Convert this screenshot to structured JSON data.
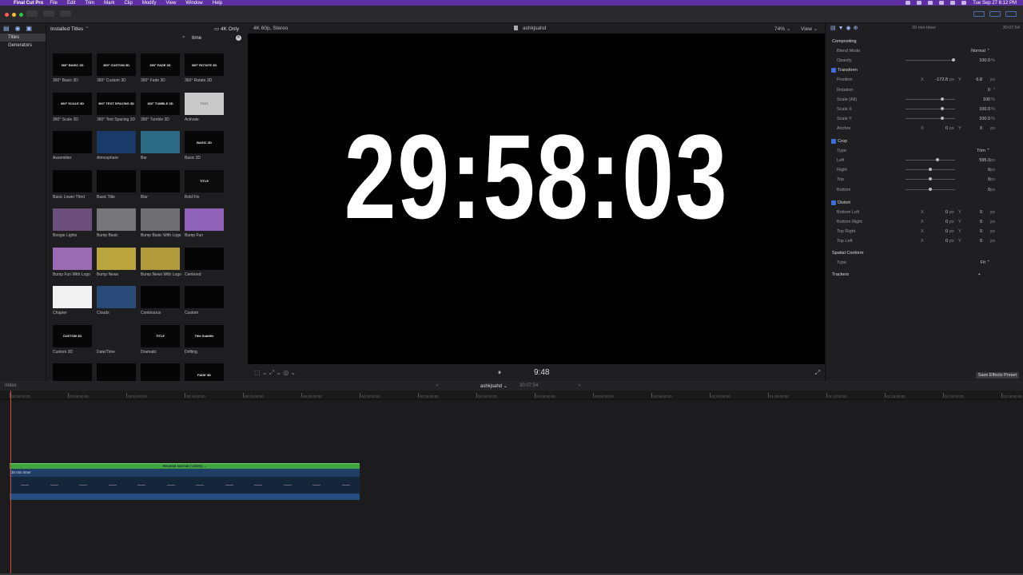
{
  "menubar": {
    "app": "Final Cut Pro",
    "items": [
      "File",
      "Edit",
      "Trim",
      "Mark",
      "Clip",
      "Modify",
      "View",
      "Window",
      "Help"
    ],
    "clock": "Tue Sep 27  6:12 PM"
  },
  "sidebar": {
    "items": [
      {
        "label": "Titles",
        "selected": true
      },
      {
        "label": "Generators",
        "selected": false
      }
    ]
  },
  "browser": {
    "title": "Installed Titles",
    "filter": "4K Only",
    "search_value": "time",
    "tiles": [
      {
        "name": "360° Basic 3D",
        "thumb": "360° BASIC 3D",
        "bg": "#070707"
      },
      {
        "name": "360° Custom 3D",
        "thumb": "360° CUSTOM 3D",
        "bg": "#070707"
      },
      {
        "name": "360° Fade 3D",
        "thumb": "360° FADE 3D",
        "bg": "#070707"
      },
      {
        "name": "360° Rotate 3D",
        "thumb": "360° ROTATE 3D",
        "bg": "#070707"
      },
      {
        "name": "360° Scale 3D",
        "thumb": "360° SCALE 3D",
        "bg": "#070707"
      },
      {
        "name": "360° Text Spacing 3D",
        "thumb": "360° TEXT SPACING 3D",
        "bg": "#070707"
      },
      {
        "name": "360° Tumble 3D",
        "thumb": "360° TUMBLE 3D",
        "bg": "#070707"
      },
      {
        "name": "Activate",
        "thumb": "TEXT",
        "bg": "#c9c9c9"
      },
      {
        "name": "Assembler",
        "thumb": "",
        "bg": "#050505"
      },
      {
        "name": "Atmosphere",
        "thumb": "",
        "bg": "#1b3a6a"
      },
      {
        "name": "Bar",
        "thumb": "",
        "bg": "#2a6a84"
      },
      {
        "name": "Basic 3D",
        "thumb": "BASIC 3D",
        "bg": "#070707"
      },
      {
        "name": "Basic Lower Third",
        "thumb": "",
        "bg": "#050505"
      },
      {
        "name": "Basic Title",
        "thumb": "",
        "bg": "#050505"
      },
      {
        "name": "Blur",
        "thumb": "",
        "bg": "#050505"
      },
      {
        "name": "Bold Fin",
        "thumb": "TITLE",
        "bg": "#0b0b0b"
      },
      {
        "name": "Boogie Lights",
        "thumb": "",
        "bg": "#6b4f7a"
      },
      {
        "name": "Bump Basic",
        "thumb": "",
        "bg": "#77777a"
      },
      {
        "name": "Bump Basic With Logo",
        "thumb": "",
        "bg": "#6f6f72"
      },
      {
        "name": "Bump Fun",
        "thumb": "",
        "bg": "#8e63b8"
      },
      {
        "name": "Bump Fun With Logo",
        "thumb": "",
        "bg": "#9a6bb3"
      },
      {
        "name": "Bump News",
        "thumb": "",
        "bg": "#b9a43e"
      },
      {
        "name": "Bump News With Logo",
        "thumb": "",
        "bg": "#b09a3a"
      },
      {
        "name": "Centered",
        "thumb": "",
        "bg": "#050505"
      },
      {
        "name": "Chapter",
        "thumb": "",
        "bg": "#f2f2f2"
      },
      {
        "name": "Clouds",
        "thumb": "",
        "bg": "#2a4a7a"
      },
      {
        "name": "Continuous",
        "thumb": "",
        "bg": "#050505"
      },
      {
        "name": "Custom",
        "thumb": "",
        "bg": "#050505"
      },
      {
        "name": "Custom 3D",
        "thumb": "CUSTOM 3D",
        "bg": "#070707"
      },
      {
        "name": "Date/Time",
        "thumb": "",
        "bg": "#1e1e20"
      },
      {
        "name": "Dramatic",
        "thumb": "TITLE",
        "bg": "#070707"
      },
      {
        "name": "Drifting",
        "thumb": "Title Subtitle",
        "bg": "#070707"
      },
      {
        "name": "",
        "thumb": "",
        "bg": "#050505"
      },
      {
        "name": "",
        "thumb": "",
        "bg": "#050505"
      },
      {
        "name": "",
        "thumb": "",
        "bg": "#050505"
      },
      {
        "name": "",
        "thumb": "FADE 3D",
        "bg": "#070707"
      }
    ]
  },
  "viewer": {
    "format": "4K 60p, Stereo",
    "project": "ashkjsahd",
    "zoom": "74%",
    "view_menu": "View",
    "frame_text": "29:58:03",
    "timecode": "9:48"
  },
  "inspector": {
    "clip_name": "30 min timer",
    "duration": "30:07:54",
    "rows": [
      {
        "type": "section",
        "label": "Compositing"
      },
      {
        "type": "field",
        "label": "Blend Mode",
        "value": "Normal ⌃"
      },
      {
        "type": "slider",
        "label": "Opacity",
        "value": "100.0",
        "unit": "%",
        "level": 1.0
      },
      {
        "type": "section-check",
        "label": "Transform"
      },
      {
        "type": "xy",
        "label": "Position",
        "x": "-172.8",
        "x_unit": "px",
        "y": "6.8",
        "y_unit": "px"
      },
      {
        "type": "field",
        "label": "Rotation",
        "value": "0",
        "unit": "°"
      },
      {
        "type": "slider",
        "label": "Scale (All)",
        "value": "100",
        "unit": "%",
        "level": 0.75
      },
      {
        "type": "slider",
        "label": "Scale X",
        "value": "100.0",
        "unit": "%",
        "level": 0.75
      },
      {
        "type": "slider",
        "label": "Scale Y",
        "value": "100.0",
        "unit": "%",
        "level": 0.75
      },
      {
        "type": "xy",
        "label": "Anchor",
        "x": "0",
        "x_unit": "px",
        "y": "0",
        "y_unit": "px"
      },
      {
        "type": "section-check",
        "label": "Crop"
      },
      {
        "type": "field",
        "label": "Type",
        "value": "Trim ⌃"
      },
      {
        "type": "slider",
        "label": "Left",
        "value": "595.0",
        "unit": "px",
        "level": 0.65
      },
      {
        "type": "slider",
        "label": "Right",
        "value": "0",
        "unit": "px",
        "level": 0.5
      },
      {
        "type": "slider",
        "label": "Top",
        "value": "0",
        "unit": "px",
        "level": 0.5
      },
      {
        "type": "slider",
        "label": "Bottom",
        "value": "0",
        "unit": "px",
        "level": 0.5
      },
      {
        "type": "section-check",
        "label": "Distort"
      },
      {
        "type": "xy",
        "label": "Bottom Left",
        "x": "0",
        "x_unit": "px",
        "y": "0",
        "y_unit": "px"
      },
      {
        "type": "xy",
        "label": "Bottom Right",
        "x": "0",
        "x_unit": "px",
        "y": "0",
        "y_unit": "px"
      },
      {
        "type": "xy",
        "label": "Top Right",
        "x": "0",
        "x_unit": "px",
        "y": "0",
        "y_unit": "px"
      },
      {
        "type": "xy",
        "label": "Top Left",
        "x": "0",
        "x_unit": "px",
        "y": "0",
        "y_unit": "px"
      },
      {
        "type": "section",
        "label": "Spatial Conform"
      },
      {
        "type": "field",
        "label": "Type",
        "value": "Fit ⌃"
      },
      {
        "type": "section",
        "label": "Trackers",
        "value": "+"
      }
    ],
    "save_preset": "Save Effects Preset"
  },
  "timeline": {
    "index_label": "Index",
    "project": "ashkjsahd",
    "duration": "30:07:54",
    "ruler": [
      "00:00:00:00",
      "00:05:00:00",
      "00:10:00:00",
      "00:15:00:00",
      "00:20:00:00",
      "00:25:00:00",
      "00:30:00:00",
      "00:35:00:00",
      "00:40:00:00",
      "00:45:00:00",
      "00:50:00:00",
      "00:55:00:00",
      "01:00:00:00",
      "01:05:00:00",
      "01:10:00:00",
      "01:15:00:00",
      "01:20:00:00",
      "01:25:00:00"
    ],
    "effect_label": "Reverse Normal (-100%) ⌄",
    "clip_label": "30 min timer"
  }
}
